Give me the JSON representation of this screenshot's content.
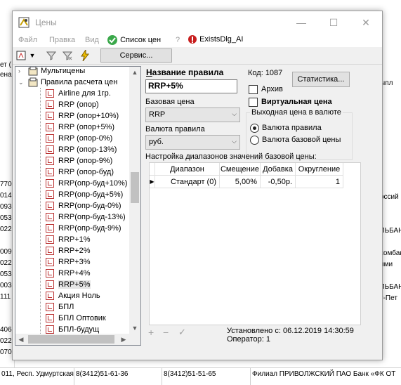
{
  "window": {
    "title": "Цены",
    "minimize": "—",
    "maximize": "☐",
    "close": "✕"
  },
  "menu": {
    "file": "Файл",
    "edit": "Правка",
    "view": "Вид",
    "price_list": "Список цен",
    "help": "?",
    "dlg": "ExistsDlg_AI"
  },
  "toolbar": {
    "service": "Сервис..."
  },
  "tree": {
    "root1": "Мультицены",
    "root2": "Правила расчета цен",
    "items": [
      "Airline для 1гр.",
      "RRP (опор)",
      "RRP (опор+10%)",
      "RRP (опор+5%)",
      "RRP (опор-0%)",
      "RRP (опор-13%)",
      "RRP (опор-9%)",
      "RRP (опор-буд)",
      "RRP(опр-буд+10%)",
      "RRP(опр-буд+5%)",
      "RRP(опр-буд-0%)",
      "RRP(опр-буд-13%)",
      "RRP(опр-буд-9%)",
      "RRP+1%",
      "RRP+2%",
      "RRP+3%",
      "RRP+4%",
      "RRP+5%",
      "Акция Ноль",
      "БПЛ",
      "БПЛ Оптовик",
      "БПЛ-будущ"
    ],
    "selected": "RRP+5%"
  },
  "form": {
    "rule_name_label": "Название правила",
    "rule_name": "RRP+5%",
    "code_label": "Код: 1087",
    "stats_button": "Статистика...",
    "archive_label": "Архив",
    "virtual_label": "Виртуальная цена",
    "base_price_label": "Базовая цена",
    "base_price_value": "RRP",
    "currency_label": "Валюта правила",
    "currency_value": "руб.",
    "output_group": "Выходная цена в валюте",
    "radio_rule": "Валюта правила",
    "radio_base": "Валюта базовой цены",
    "ranges_label": "Настройка диапазонов значений базовой цены:"
  },
  "grid": {
    "columns": [
      "Диапазон",
      "Смещение",
      "Добавка",
      "Округление"
    ],
    "rows": [
      {
        "range": "Стандарт (0)",
        "offset": "5,00%",
        "add": "-0,50р.",
        "round": "1"
      }
    ]
  },
  "footer": {
    "add": "+",
    "remove": "−",
    "apply": "✓",
    "installed": "Установлено с: 06.12.2019 14:30:59",
    "operator": "Оператор: 1"
  },
  "background": {
    "left_fragments": [
      "ет (",
      "ена",
      "770",
      "014",
      "093",
      "053",
      "022",
      "009",
      "022",
      "053",
      "003",
      "111",
      "406",
      "022",
      "070"
    ],
    "right_fragments": [
      "ыпл",
      "оссий",
      "ЛЬБАНК",
      "хомбан",
      "ими",
      "ЛЬБАНК",
      "т-Пет"
    ],
    "bottom_row": "011, Респ. Удмуртская",
    "phone1": "8(3412)51-61-36",
    "phone2": "8(3412)51-51-65",
    "bank": "Филиал ПРИВОЛЖСКИЙ ПАО Банк «ФК ОТ"
  }
}
